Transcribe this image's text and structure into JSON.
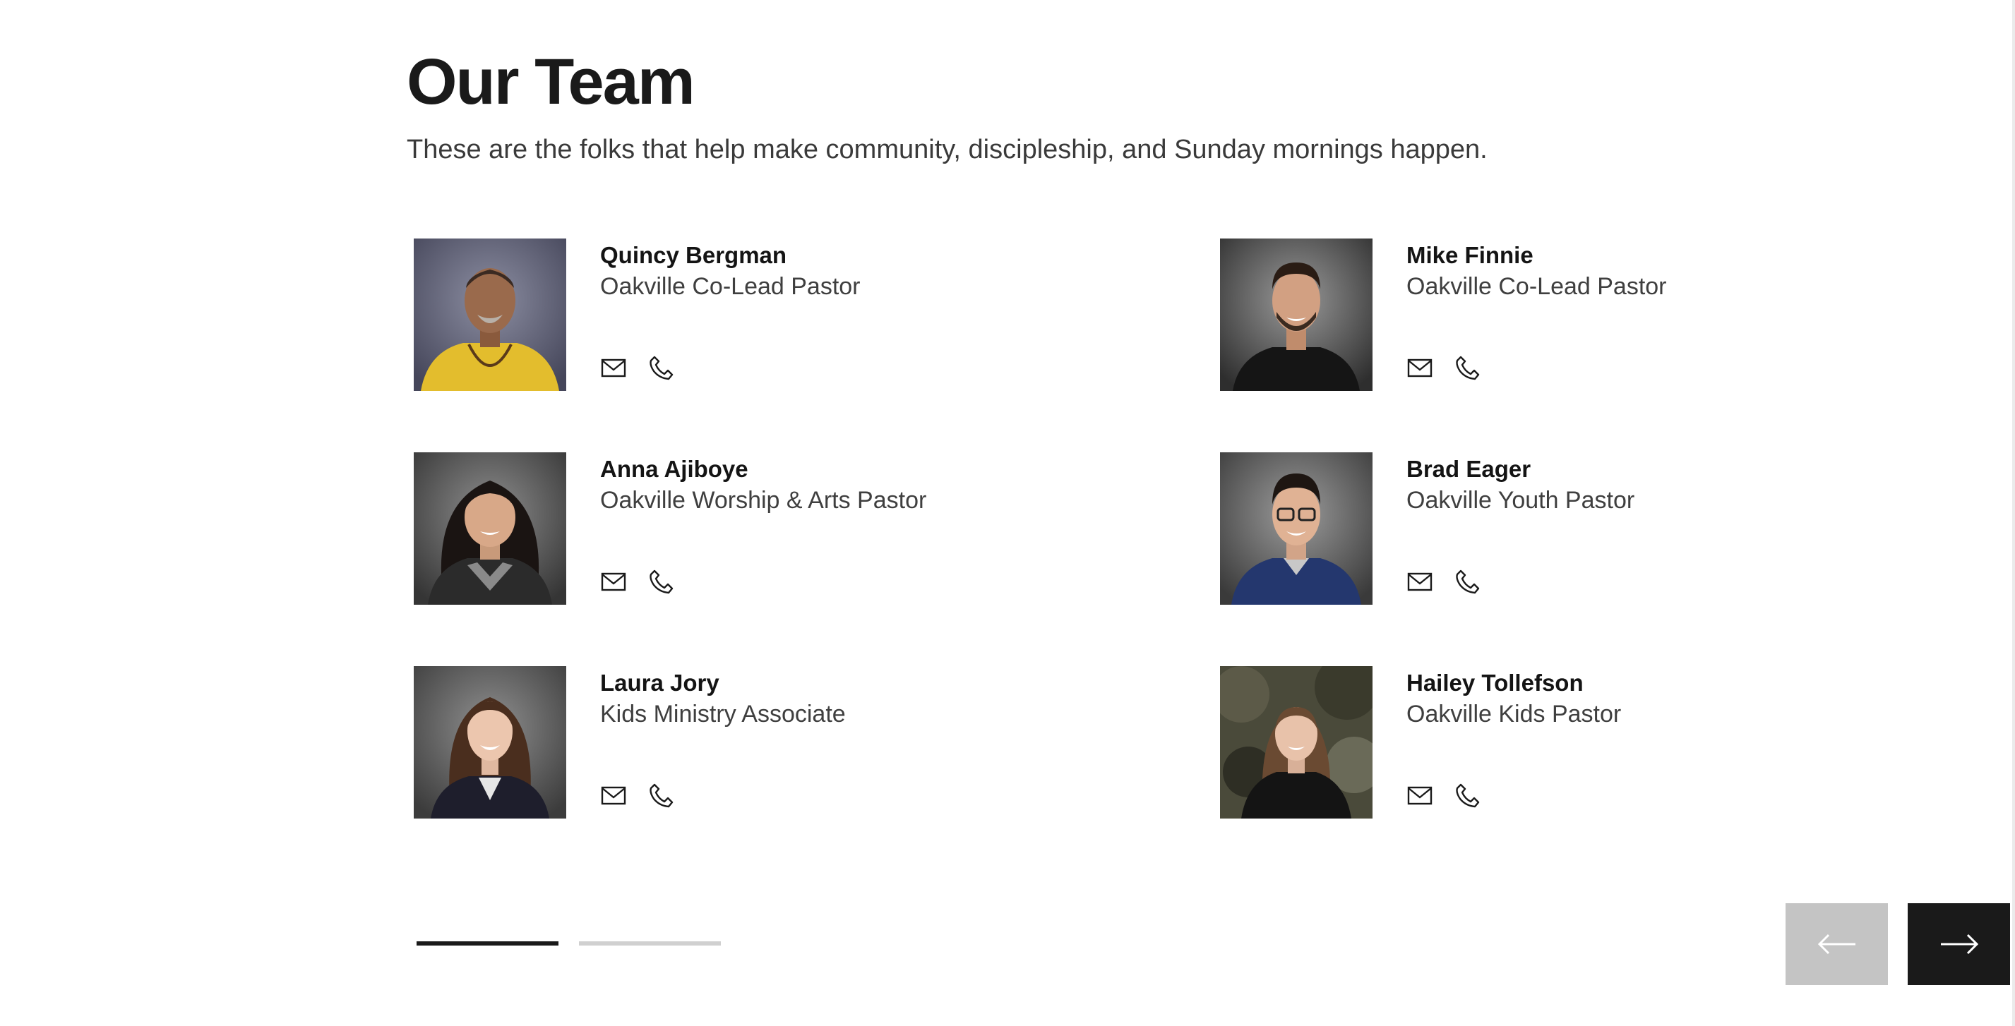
{
  "header": {
    "title": "Our Team",
    "subtitle": "These are the folks that help make community, discipleship, and Sunday mornings happen."
  },
  "team": [
    {
      "name": "Quincy Bergman",
      "role": "Oakville Co-Lead Pastor",
      "photo_alt": "Quincy Bergman"
    },
    {
      "name": "Mike Finnie",
      "role": "Oakville Co-Lead Pastor",
      "photo_alt": "Mike Finnie"
    },
    {
      "name": "Anna Ajiboye",
      "role": "Oakville Worship & Arts Pastor",
      "photo_alt": "Anna Ajiboye"
    },
    {
      "name": "Brad Eager",
      "role": "Oakville Youth Pastor",
      "photo_alt": "Brad Eager"
    },
    {
      "name": "Laura Jory",
      "role": "Kids Ministry Associate",
      "photo_alt": "Laura Jory"
    },
    {
      "name": "Hailey Tollefson",
      "role": "Oakville Kids Pastor",
      "photo_alt": "Hailey Tollefson"
    }
  ],
  "icons": {
    "email": "envelope-icon",
    "phone": "phone-icon",
    "prev": "arrow-left-icon",
    "next": "arrow-right-icon"
  },
  "pagination": {
    "current_page": 1,
    "total_pages": 2
  },
  "colors": {
    "text_primary": "#1a1a1a",
    "text_secondary": "#3f3f3f",
    "pager_active": "#1a1a1a",
    "pager_inactive": "#d0d0d0",
    "prev_button": "#c4c4c4",
    "next_button": "#1a1a1a"
  }
}
